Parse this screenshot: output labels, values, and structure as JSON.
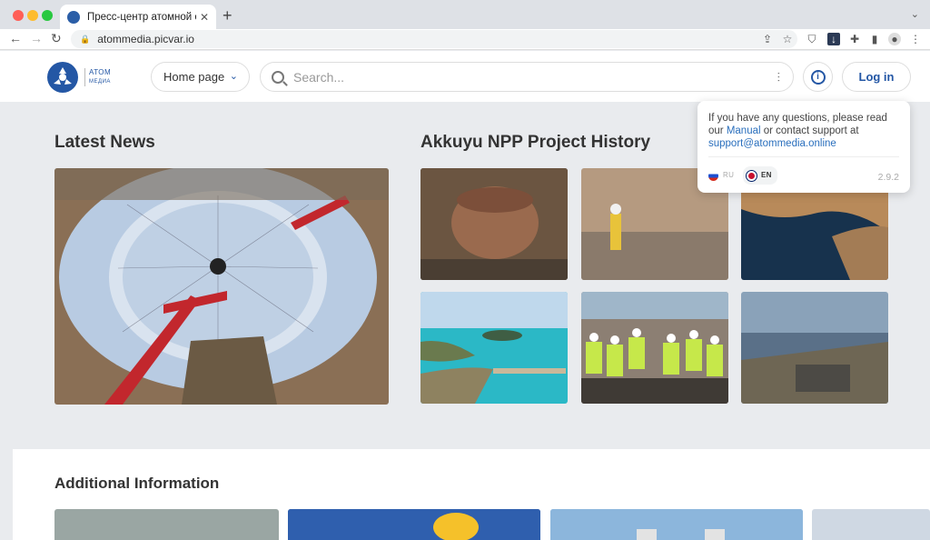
{
  "browser": {
    "tab_title": "Пресс-центр атомной отрасли",
    "url": "atommedia.picvar.io"
  },
  "header": {
    "logo_line1": "АТОМ",
    "logo_line2": "МЕДИА",
    "nav_select": "Home page",
    "search_placeholder": "Search...",
    "login_label": "Log in"
  },
  "popover": {
    "text_before": "If you have any questions, please read our ",
    "manual_link": "Manual",
    "text_middle": " or contact support at ",
    "support_email": "support@atommedia.online",
    "lang_ru": "RU",
    "lang_en": "EN",
    "version": "2.9.2"
  },
  "sections": {
    "latest_news": "Latest News",
    "project_history": "Akkuyu NPP Project History",
    "additional_info": "Additional Information"
  },
  "colors": {
    "brand": "#2457a5",
    "link": "#2a6fbd"
  }
}
